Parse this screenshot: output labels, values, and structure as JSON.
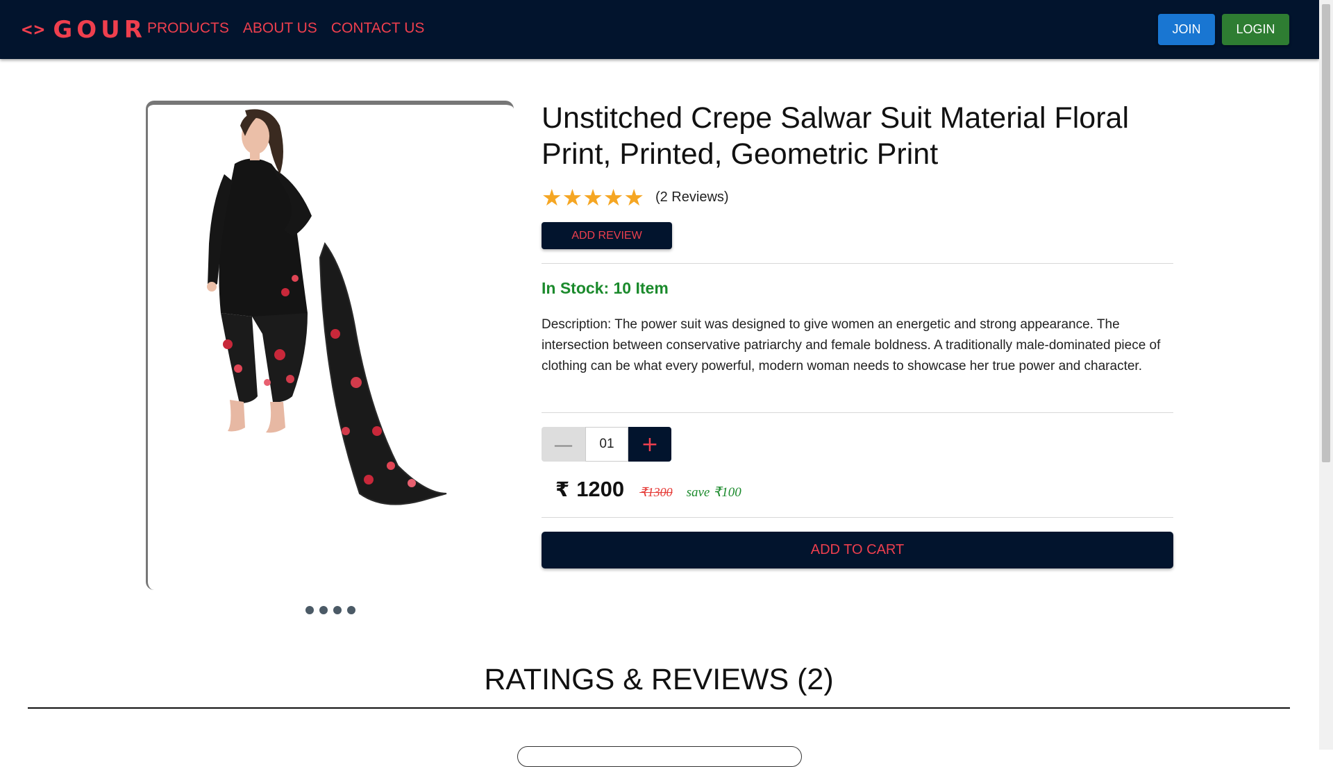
{
  "navbar": {
    "brand_icon": "<>",
    "brand_text": "GOUR",
    "links": [
      "PRODUCTS",
      "ABOUT US",
      "CONTACT US"
    ],
    "join_label": "JOIN",
    "login_label": "LOGIN"
  },
  "product": {
    "title": "Unstitched Crepe Salwar Suit Material Floral Print, Printed, Geometric Print",
    "rating": 5,
    "stars": [
      "★",
      "★",
      "★",
      "★",
      "★"
    ],
    "reviews_count_text": "(2 Reviews)",
    "add_review_label": "ADD REVIEW",
    "stock_text": "In Stock: 10 Item",
    "description": "Description: The power suit was designed to give women an energetic and strong appearance. The intersection between conservative patriarchy and female boldness. A traditionally male-dominated piece of clothing can be what every powerful, modern woman needs to showcase her true power and character.",
    "quantity": "01",
    "qty_minus": "—",
    "qty_plus": "+",
    "currency_symbol": "₹",
    "price": "1200",
    "old_price": "₹1300",
    "save_text": "save ₹100",
    "add_to_cart_label": "ADD TO CART",
    "carousel_slides": 4
  },
  "reviews": {
    "heading": "RATINGS & REVIEWS (2)"
  },
  "colors": {
    "navy": "#02142d",
    "accent_red": "#ef3f4e",
    "join_blue": "#1976d2",
    "login_green": "#2e7d32",
    "stock_green": "#1b8a2c",
    "star_gold": "#f5a623"
  }
}
